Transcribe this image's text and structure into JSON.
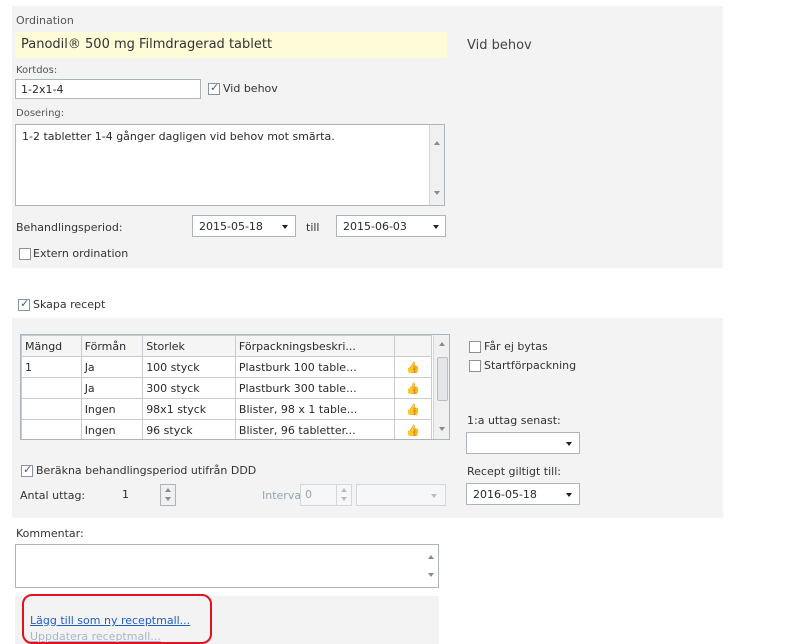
{
  "ordination": {
    "section_label": "Ordination",
    "drug_name": "Panodil® 500 mg Filmdragerad tablett",
    "vid_behov_text": "Vid behov",
    "kortdos_label": "Kortdos:",
    "kortdos_value": "1-2x1-4",
    "vid_behov_checkbox": "Vid behov",
    "dosering_label": "Dosering:",
    "dosering_value": "1-2 tabletter 1-4 gånger dagligen vid behov mot smärta.",
    "behandlingsperiod_label": "Behandlingsperiod:",
    "start_date": "2015-05-18",
    "till_label": "till",
    "end_date": "2015-06-03",
    "extern_label": "Extern ordination"
  },
  "recept": {
    "skapa_label": "Skapa recept",
    "table": {
      "columns": [
        "Mängd",
        "Förmån",
        "Storlek",
        "Förpackningsbeskri..."
      ],
      "rows": [
        {
          "mangd": "1",
          "forman": "Ja",
          "storlek": "100 styck",
          "beskr": "Plastburk 100 table..."
        },
        {
          "mangd": "",
          "forman": "Ja",
          "storlek": "300 styck",
          "beskr": "Plastburk 300 table..."
        },
        {
          "mangd": "",
          "forman": "Ingen",
          "storlek": "98x1 styck",
          "beskr": "Blister, 98 x 1 table..."
        },
        {
          "mangd": "",
          "forman": "Ingen",
          "storlek": "96 styck",
          "beskr": "Blister, 96 tabletter..."
        }
      ]
    },
    "far_ej_bytas": "Får ej bytas",
    "startforpackning": "Startförpackning",
    "forsta_uttag_label": "1:a uttag senast:",
    "forsta_uttag_value": "",
    "berakna_label": "Beräkna behandlingsperiod utifrån DDD",
    "antal_uttag_label": "Antal uttag:",
    "antal_uttag_value": "1",
    "intervall_label": "Intervall:",
    "intervall_value": "0",
    "recept_giltigt_label": "Recept giltigt till:",
    "recept_giltigt_value": "2016-05-18"
  },
  "kommentar": {
    "label": "Kommentar:",
    "value": ""
  },
  "links": {
    "add_template": "Lägg till som ny receptmall...",
    "update_template": "Uppdatera receptmall..."
  },
  "colors": {
    "highlight_yellow": "#fdfbd8",
    "panel_gray": "#f3f3f3",
    "callout_red": "#e0141e",
    "link_blue": "#1f5fc4"
  }
}
